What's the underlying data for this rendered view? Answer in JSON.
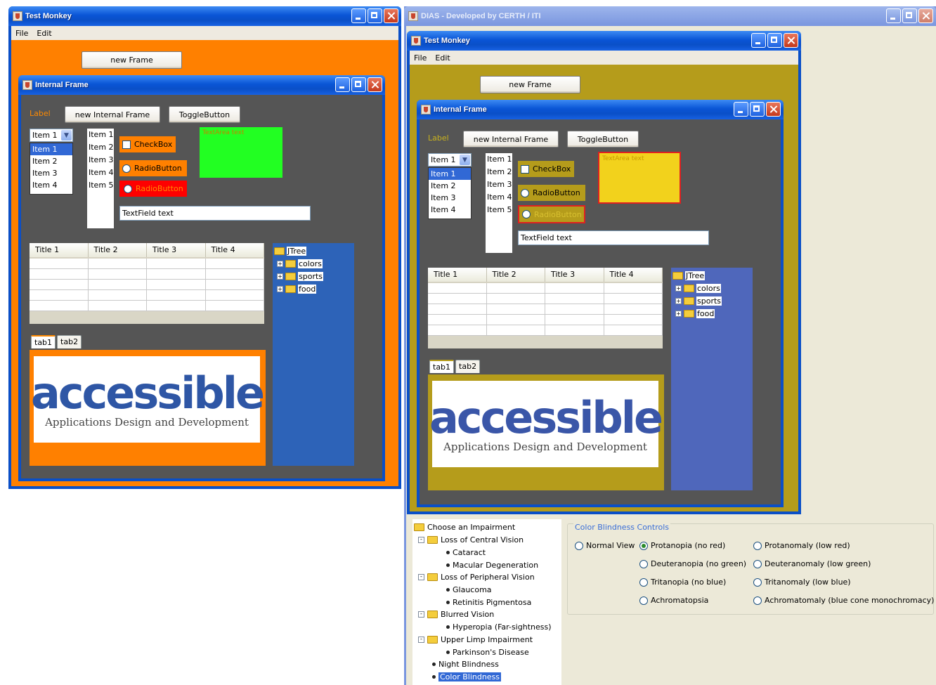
{
  "left_window": {
    "title": "Test Monkey",
    "menu": [
      "File",
      "Edit"
    ],
    "new_frame_label": "new Frame",
    "bg_color": "#ff8000",
    "internal": {
      "title": "Internal Frame",
      "label": "Label",
      "new_internal_label": "new Internal Frame",
      "toggle_label": "ToggleButton",
      "combo_value": "Item 1",
      "combo_items": [
        "Item 1",
        "Item 2",
        "Item 3",
        "Item 4"
      ],
      "list_items": [
        "Item 1",
        "Item 2",
        "Item 3",
        "Item 4",
        "Item 5"
      ],
      "checkbox_label": "CheckBox",
      "radio1_label": "RadioButton",
      "radio2_label": "RadioButton",
      "textarea_text": "TextArea text",
      "textarea_color": "#22ff22",
      "textfield_text": "TextField text",
      "table_headers": [
        "Title 1",
        "Title 2",
        "Title 3",
        "Title 4"
      ],
      "tree_root": "JTree",
      "tree_nodes": [
        "colors",
        "sports",
        "food"
      ],
      "tree_bg": "#2d63b8",
      "tabs": [
        "tab1",
        "tab2"
      ],
      "logo_word": "accessible",
      "logo_sub": "Applications Design and Development"
    }
  },
  "dias_window": {
    "title": "DIAS - Developed by CERTH / ITI",
    "inner": {
      "title": "Test Monkey",
      "menu": [
        "File",
        "Edit"
      ],
      "new_frame_label": "new Frame",
      "bg_color": "#b59c1b",
      "internal": {
        "title": "Internal Frame",
        "label": "Label",
        "new_internal_label": "new Internal Frame",
        "toggle_label": "ToggleButton",
        "combo_value": "Item 1",
        "combo_items": [
          "Item 1",
          "Item 2",
          "Item 3",
          "Item 4"
        ],
        "list_items": [
          "Item 1",
          "Item 2",
          "Item 3",
          "Item 4",
          "Item 5"
        ],
        "checkbox_label": "CheckBox",
        "radio1_label": "RadioButton",
        "radio2_label": "RadioButton",
        "textarea_text": "TextArea text",
        "textarea_color": "#f2d21c",
        "textfield_text": "TextField text",
        "table_headers": [
          "Title 1",
          "Title 2",
          "Title 3",
          "Title 4"
        ],
        "tree_root": "JTree",
        "tree_nodes": [
          "colors",
          "sports",
          "food"
        ],
        "tree_bg": "#4f67bb",
        "tabs": [
          "tab1",
          "tab2"
        ],
        "logo_word": "accessible",
        "logo_sub": "Applications Design and Development"
      }
    },
    "impairment_tree": {
      "root": "Choose an Impairment",
      "groups": [
        {
          "label": "Loss of Central Vision",
          "children": [
            "Cataract",
            "Macular Degeneration"
          ]
        },
        {
          "label": "Loss of Peripheral Vision",
          "children": [
            "Glaucoma",
            "Retinitis Pigmentosa"
          ]
        },
        {
          "label": "Blurred Vision",
          "children": [
            "Hyperopia (Far-sightness)"
          ]
        },
        {
          "label": "Upper Limp Impairment",
          "children": [
            "Parkinson's Disease"
          ]
        }
      ],
      "leaves": [
        "Night Blindness",
        "Color Blindness"
      ],
      "selected": "Color Blindness"
    },
    "color_controls": {
      "title": "Color Blindness Controls",
      "normal": "Normal View",
      "protanopia": "Protanopia (no red)",
      "protanomaly": "Protanomaly (low red)",
      "deuteranopia": "Deuteranopia (no green)",
      "deuteranomaly": "Deuteranomaly (low green)",
      "tritanopia": "Tritanopia (no blue)",
      "tritanomaly": "Tritanomaly (low blue)",
      "achromatopsia": "Achromatopsia",
      "achromatomaly": "Achromatomaly (blue cone monochromacy)",
      "selected": "Protanopia (no red)"
    }
  }
}
